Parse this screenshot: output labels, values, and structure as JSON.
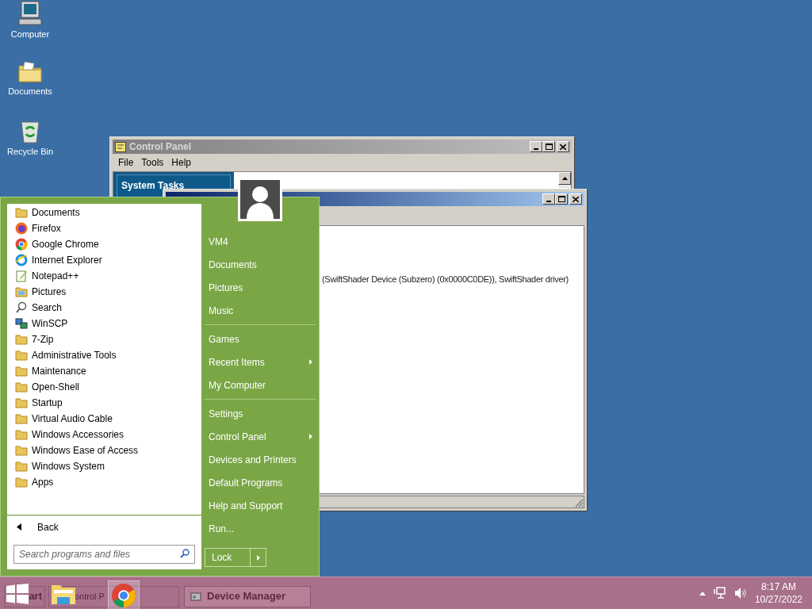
{
  "desktop_icons": [
    {
      "label": "Computer",
      "kind": "computer"
    },
    {
      "label": "Documents",
      "kind": "documents"
    },
    {
      "label": "Recycle Bin",
      "kind": "recycle"
    }
  ],
  "control_panel": {
    "title": "Control Panel",
    "menu": [
      "File",
      "Tools",
      "Help"
    ],
    "task_header": "System Tasks"
  },
  "device_manager": {
    "detail": "(SwiftShader Device (Subzero) (0x0000C0DE)), SwiftShader driver)"
  },
  "start_menu": {
    "programs": [
      {
        "label": "Documents",
        "kind": "folder"
      },
      {
        "label": "Firefox",
        "kind": "firefox"
      },
      {
        "label": "Google Chrome",
        "kind": "chrome"
      },
      {
        "label": "Internet Explorer",
        "kind": "ie"
      },
      {
        "label": "Notepad++",
        "kind": "notepad"
      },
      {
        "label": "Pictures",
        "kind": "pictures"
      },
      {
        "label": "Search",
        "kind": "search"
      },
      {
        "label": "WinSCP",
        "kind": "winscp"
      },
      {
        "label": "7-Zip",
        "kind": "folder"
      },
      {
        "label": "Administrative Tools",
        "kind": "folder"
      },
      {
        "label": "Maintenance",
        "kind": "folder"
      },
      {
        "label": "Open-Shell",
        "kind": "folder"
      },
      {
        "label": "Startup",
        "kind": "folder"
      },
      {
        "label": "Virtual Audio Cable",
        "kind": "folder"
      },
      {
        "label": "Windows Accessories",
        "kind": "folder"
      },
      {
        "label": "Windows Ease of Access",
        "kind": "folder"
      },
      {
        "label": "Windows System",
        "kind": "folder"
      },
      {
        "label": "Apps",
        "kind": "folder"
      }
    ],
    "back": "Back",
    "search_placeholder": "Search programs and files",
    "places": [
      {
        "kind": "item",
        "label": "VM4",
        "submenu": false
      },
      {
        "kind": "item",
        "label": "Documents",
        "submenu": false
      },
      {
        "kind": "item",
        "label": "Pictures",
        "submenu": false
      },
      {
        "kind": "item",
        "label": "Music",
        "submenu": false
      },
      {
        "kind": "separator"
      },
      {
        "kind": "item",
        "label": "Games",
        "submenu": false
      },
      {
        "kind": "item",
        "label": "Recent Items",
        "submenu": true
      },
      {
        "kind": "item",
        "label": "My Computer",
        "submenu": false
      },
      {
        "kind": "separator"
      },
      {
        "kind": "item",
        "label": "Settings",
        "submenu": false
      },
      {
        "kind": "item",
        "label": "Control Panel",
        "submenu": true
      },
      {
        "kind": "item",
        "label": "Devices and Printers",
        "submenu": false
      },
      {
        "kind": "item",
        "label": "Default Programs",
        "submenu": false
      },
      {
        "kind": "item",
        "label": "Help and Support",
        "submenu": false
      },
      {
        "kind": "item",
        "label": "Run...",
        "submenu": false
      }
    ],
    "lock": "Lock"
  },
  "taskbar": {
    "buttons": [
      {
        "label": "art",
        "kind": "start"
      },
      {
        "label": "ontrol P",
        "kind": "explorer"
      },
      {
        "label": "Device Manager",
        "kind": "device"
      }
    ],
    "time": "8:17 AM",
    "date": "10/27/2022"
  }
}
